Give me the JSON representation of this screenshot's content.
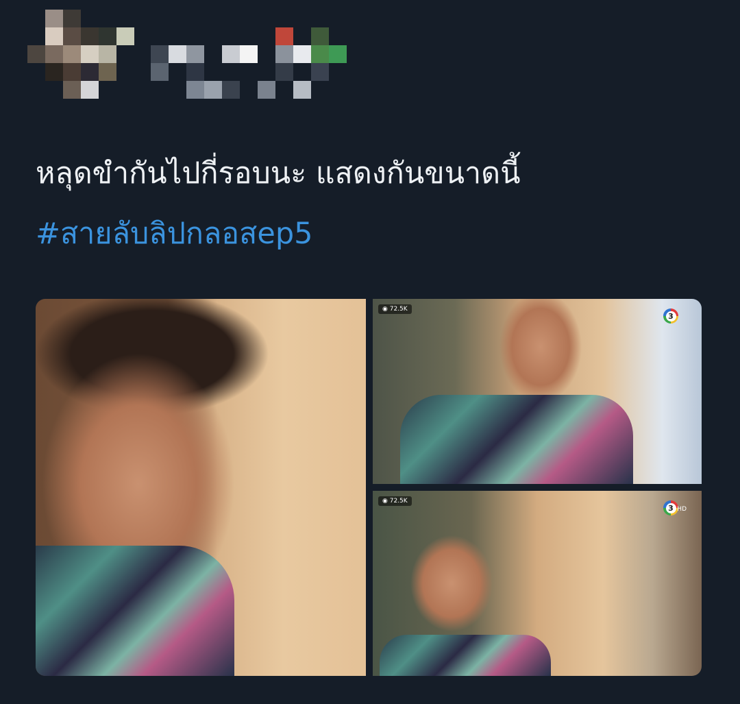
{
  "tweet": {
    "text": "หลุดขำกันไปกี่รอบนะ แสดงกันขนาดนี้",
    "hashtag": "#สายลับลิปกลอสep5"
  },
  "media": {
    "top_right": {
      "views": "72.5K",
      "channel": "3"
    },
    "bottom_right": {
      "views": "72.5K",
      "channel": "3",
      "quality": "HD"
    }
  },
  "colors": {
    "background": "#151d28",
    "text": "#eef1f4",
    "hashtag": "#3b93de"
  }
}
